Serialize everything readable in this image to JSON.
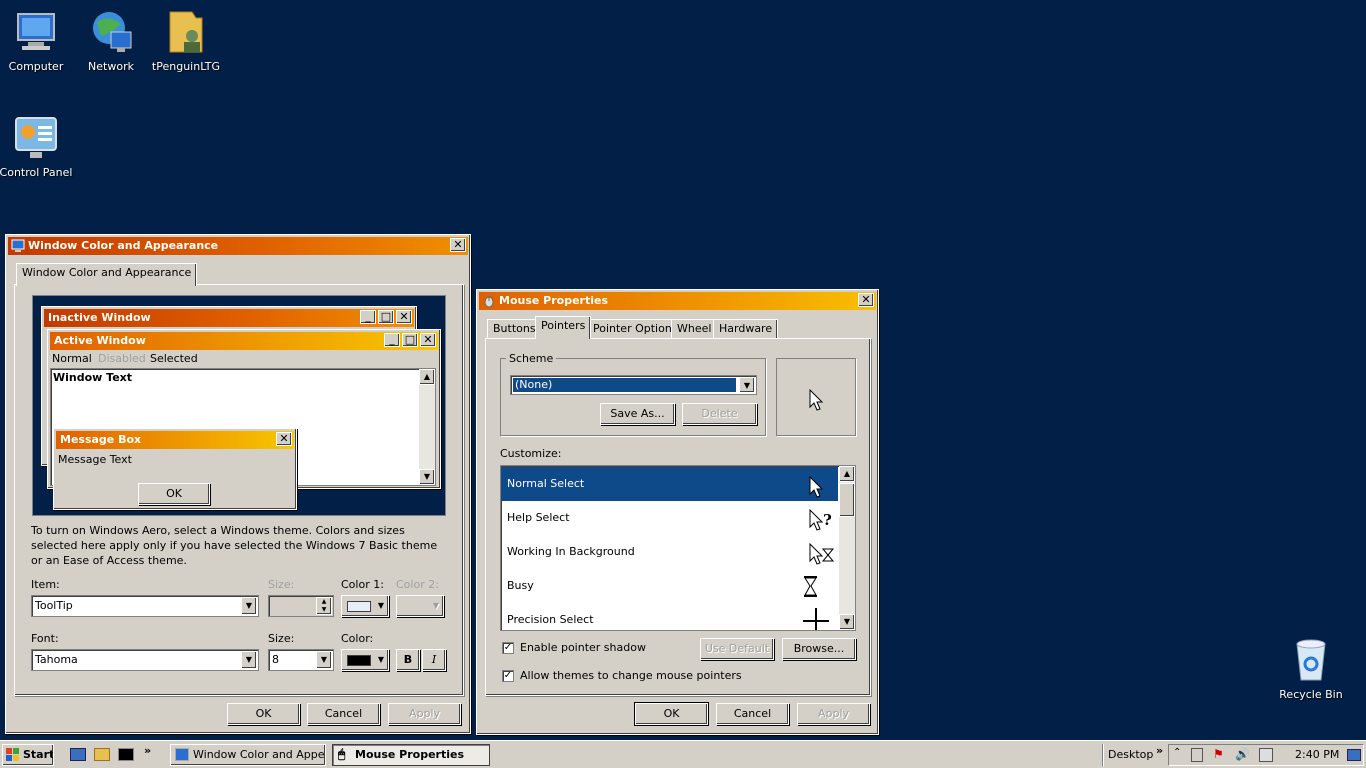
{
  "desktop": {
    "icons": [
      {
        "label": "Computer"
      },
      {
        "label": "Network"
      },
      {
        "label": "tPenguinLTG"
      },
      {
        "label": "Control Panel"
      },
      {
        "label": "Recycle Bin"
      }
    ]
  },
  "wca": {
    "title": "Window Color and Appearance",
    "tab": "Window Color and Appearance",
    "preview": {
      "inactive_title": "Inactive Window",
      "active_title": "Active Window",
      "menu": [
        "Normal",
        "Disabled",
        "Selected"
      ],
      "window_text": "Window Text",
      "msgbox_title": "Message Box",
      "msgbox_text": "Message Text",
      "msgbox_ok": "OK"
    },
    "description": "To turn on Windows Aero, select a Windows theme.  Colors and sizes selected here apply only if you have selected the Windows 7 Basic theme or an Ease of Access theme.",
    "item_label": "Item:",
    "item_value": "ToolTip",
    "size_label": "Size:",
    "color1_label": "Color 1:",
    "color2_label": "Color 2:",
    "font_label": "Font:",
    "font_value": "Tahoma",
    "font_size_label": "Size:",
    "font_size_value": "8",
    "font_color_label": "Color:",
    "bold": "B",
    "italic": "I",
    "ok": "OK",
    "cancel": "Cancel",
    "apply": "Apply"
  },
  "mouse": {
    "title": "Mouse Properties",
    "tabs": [
      "Buttons",
      "Pointers",
      "Pointer Options",
      "Wheel",
      "Hardware"
    ],
    "scheme_label": "Scheme",
    "scheme_value": "(None)",
    "save_as": "Save As...",
    "delete": "Delete",
    "customize_label": "Customize:",
    "pointers": [
      {
        "name": "Normal Select"
      },
      {
        "name": "Help Select"
      },
      {
        "name": "Working In Background"
      },
      {
        "name": "Busy"
      },
      {
        "name": "Precision Select"
      }
    ],
    "enable_shadow": "Enable pointer shadow",
    "use_default": "Use Default",
    "browse": "Browse...",
    "allow_themes": "Allow themes to change mouse pointers",
    "ok": "OK",
    "cancel": "Cancel",
    "apply": "Apply"
  },
  "taskbar": {
    "start": "Start",
    "tasks": [
      "Window Color and Appe...",
      "Mouse Properties"
    ],
    "desktop_label": "Desktop",
    "clock": "2:40 PM"
  }
}
